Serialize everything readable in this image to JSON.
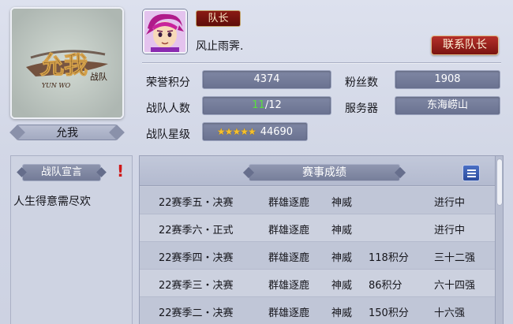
{
  "team": {
    "name": "允我",
    "logo_text": "允我",
    "logo_small_text": "战队",
    "logo_latin": "YUN WO"
  },
  "captain": {
    "badge": "队长",
    "name": "风止雨霁.",
    "contact_button": "联系队长"
  },
  "stats": {
    "honor_label": "荣誉积分",
    "honor_value": "4374",
    "fans_label": "粉丝数",
    "fans_value": "1908",
    "members_label": "战队人数",
    "members_current": "11",
    "members_total": "/12",
    "server_label": "服务器",
    "server_value": "东海崂山",
    "stars_label": "战队星级",
    "stars_icons": "★★★★★",
    "stars_value": "44690"
  },
  "declaration": {
    "title": "战队宣言",
    "alert": "!",
    "text": "人生得意需尽欢"
  },
  "results": {
    "title": "赛事成绩",
    "rows": [
      {
        "event": "22赛季五・决赛",
        "group": "群雄逐鹿",
        "tier": "神威",
        "points": "",
        "status": "进行中"
      },
      {
        "event": "22赛季六・正式",
        "group": "群雄逐鹿",
        "tier": "神威",
        "points": "",
        "status": "进行中"
      },
      {
        "event": "22赛季四・决赛",
        "group": "群雄逐鹿",
        "tier": "神威",
        "points": "118积分",
        "status": "三十二强"
      },
      {
        "event": "22赛季三・决赛",
        "group": "群雄逐鹿",
        "tier": "神威",
        "points": "86积分",
        "status": "六十四强"
      },
      {
        "event": "22赛季二・决赛",
        "group": "群雄逐鹿",
        "tier": "神威",
        "points": "150积分",
        "status": "十六强"
      }
    ]
  },
  "colors": {
    "accent_red": "#8a1a14",
    "value_box": "#757d9a",
    "member_green": "#58e03c",
    "star_gold": "#f6c12a"
  }
}
